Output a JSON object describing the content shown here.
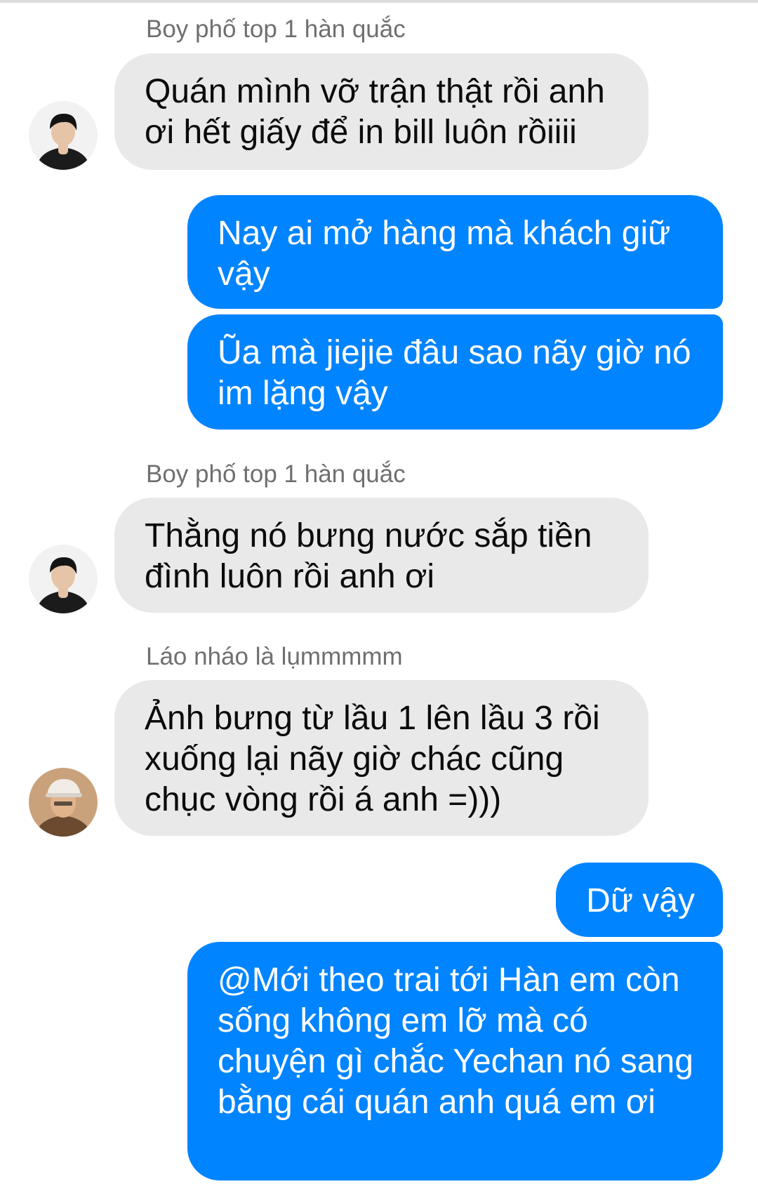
{
  "thread": {
    "messages": [
      {
        "id": "m1",
        "side": "incoming",
        "sender": "Boy phố top 1 hàn quắc",
        "text": "Quán mình vỡ trận thật rồi anh ơi hết giấy để in bill luôn rồiiii"
      },
      {
        "id": "m2",
        "side": "outgoing",
        "text": "Nay ai mở hàng mà khách giữ vậy"
      },
      {
        "id": "m3",
        "side": "outgoing",
        "text": "Ũa mà jiejie đâu sao nãy giờ nó im lặng vậy"
      },
      {
        "id": "m4",
        "side": "incoming",
        "sender": "Boy phố top 1 hàn quắc",
        "text": "Thằng nó bưng nước sắp tiền đình luôn rồi anh ơi"
      },
      {
        "id": "m5",
        "side": "incoming",
        "sender": "Láo nháo là lụmmmmm",
        "text": "Ảnh bưng từ lầu 1 lên lầu 3 rồi xuống lại nãy giờ chác cũng chục vòng rồi á anh =)))"
      },
      {
        "id": "m6",
        "side": "outgoing",
        "text": "Dữ vậy"
      },
      {
        "id": "m7",
        "side": "outgoing",
        "text": "@Mới theo trai tới Hàn em còn sống không em lỡ mà có chuyện gì chắc Yechan nó sang bằng cái quán anh quá em ơi"
      }
    ]
  },
  "colors": {
    "outgoing_bubble": "#0084ff",
    "incoming_bubble": "#e9e9e9",
    "sender_label": "#6f6f6f"
  },
  "icons": {
    "avatar_boy_pho": "avatar-dark-hair-photo",
    "avatar_lao_nhao": "avatar-cap-photo"
  }
}
